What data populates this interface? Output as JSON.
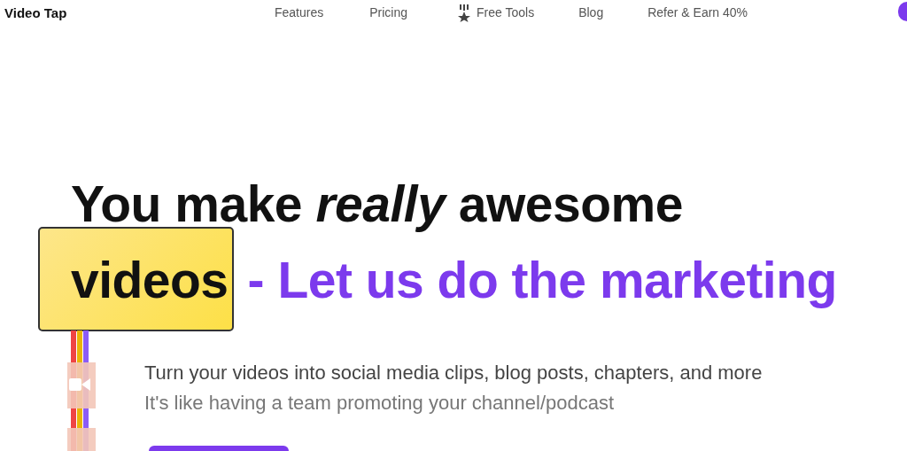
{
  "nav": {
    "brand": "Video Tap",
    "links": [
      {
        "label": "Features",
        "kind": "text"
      },
      {
        "label": "Pricing",
        "kind": "text"
      },
      {
        "label": "Free Tools",
        "kind": "medal"
      },
      {
        "label": "Blog",
        "kind": "text"
      },
      {
        "label": "Refer & Earn 40%",
        "kind": "text"
      }
    ]
  },
  "hero": {
    "headline_line_1": "You make *really* awesome",
    "headline_highlight": "videos",
    "headline_accent": "- Let us do the marketing",
    "subtitle": "Turn your videos into social media clips, blog posts, chapters, and more",
    "tagline": "It's like having a team promoting your channel/podcast"
  }
}
